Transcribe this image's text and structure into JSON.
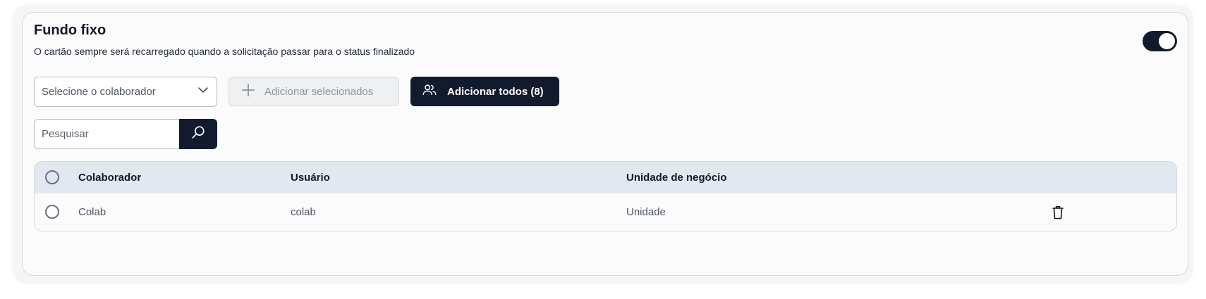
{
  "section": {
    "title": "Fundo fixo",
    "subtitle": "O cartão sempre será recarregado quando a solicitação passar para o status finalizado",
    "toggle_on": true
  },
  "toolbar": {
    "select_placeholder": "Selecione o colaborador",
    "add_selected_label": "Adicionar selecionados",
    "add_all_label": "Adicionar todos (8)"
  },
  "search": {
    "placeholder": "Pesquisar",
    "value": ""
  },
  "table": {
    "headers": [
      "Colaborador",
      "Usuário",
      "Unidade de negócio"
    ],
    "rows": [
      {
        "colaborador": "Colab",
        "usuario": "colab",
        "unidade": "Unidade"
      }
    ]
  },
  "icons": {
    "select_chevron": "chevron-down-icon",
    "add_selected": "plus-icon",
    "add_all": "users-icon",
    "search": "search-icon",
    "row_delete": "trash-icon"
  },
  "colors": {
    "primary_dark": "#121b2e",
    "header_bg": "#e2e8f0",
    "card_bg": "#fbfbfb"
  }
}
